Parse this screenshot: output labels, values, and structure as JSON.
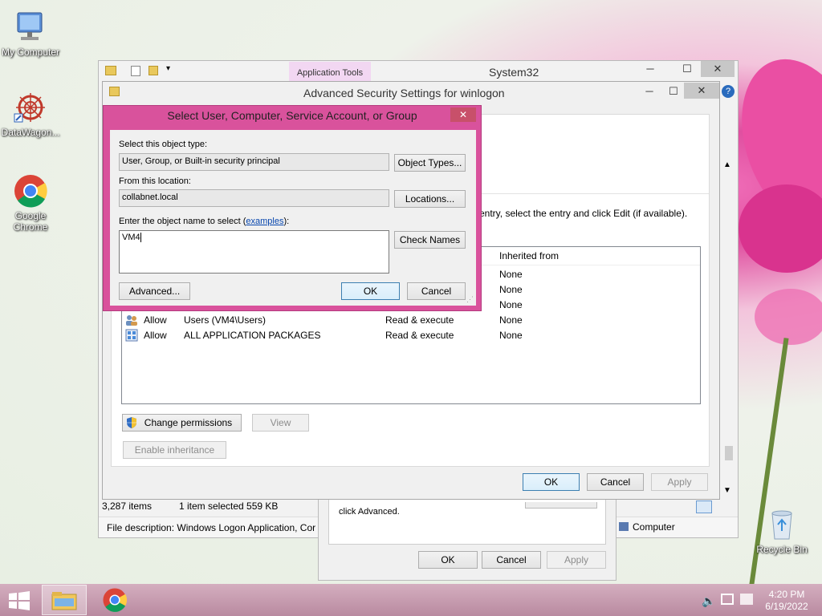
{
  "desktop": {
    "icons": [
      {
        "label": "My Computer",
        "icon": "computer-icon"
      },
      {
        "label": "DataWagon...",
        "icon": "datawagon-icon"
      },
      {
        "label": "Google Chrome",
        "icon": "chrome-icon"
      },
      {
        "label": "Recycle Bin",
        "icon": "recycle-bin-icon"
      }
    ]
  },
  "explorer": {
    "title": "System32",
    "ribbon_tab": "Application Tools",
    "status_items": "3,287 items",
    "status_selected": "1 item selected  559 KB",
    "file_description": "File description: Windows Logon Application, Cor",
    "computer_label": "Computer"
  },
  "advanced_security": {
    "title": "Advanced Security Settings for winlogon",
    "instruction": "entry, select the entry and click Edit (if available).",
    "column_inherited": "Inherited from",
    "entries": [
      {
        "type": "",
        "principal": "",
        "access": "",
        "inherited": "None"
      },
      {
        "type": "",
        "principal": "",
        "access": "",
        "inherited": "None"
      },
      {
        "type": "",
        "principal": "",
        "access": "",
        "inherited": "None"
      },
      {
        "type": "Allow",
        "principal": "Users (VM4\\Users)",
        "access": "Read & execute",
        "inherited": "None"
      },
      {
        "type": "Allow",
        "principal": "ALL APPLICATION PACKAGES",
        "access": "Read & execute",
        "inherited": "None"
      }
    ],
    "change_permissions": "Change permissions",
    "view": "View",
    "enable_inheritance": "Enable inheritance",
    "ok": "OK",
    "cancel": "Cancel",
    "apply": "Apply"
  },
  "properties": {
    "advanced_text": "click Advanced.",
    "ok": "OK",
    "cancel": "Cancel",
    "apply": "Apply"
  },
  "select_dialog": {
    "title": "Select User, Computer, Service Account, or Group",
    "object_type_label": "Select this object type:",
    "object_type_value": "User, Group, or Built-in security principal",
    "object_types_button": "Object Types...",
    "location_label": "From this location:",
    "location_value": "collabnet.local",
    "locations_button": "Locations...",
    "name_label_prefix": "Enter the object name to select (",
    "name_label_link": "examples",
    "name_label_suffix": "):",
    "name_value": "VM4",
    "check_names_button": "Check Names",
    "advanced_button": "Advanced...",
    "ok_button": "OK",
    "cancel_button": "Cancel"
  },
  "taskbar": {
    "time": "4:20 PM",
    "date": "6/19/2022"
  },
  "colors": {
    "dialog_border": "#d9529c",
    "taskbar": "#c59bb0",
    "default_button_border": "#3c7fb1"
  }
}
